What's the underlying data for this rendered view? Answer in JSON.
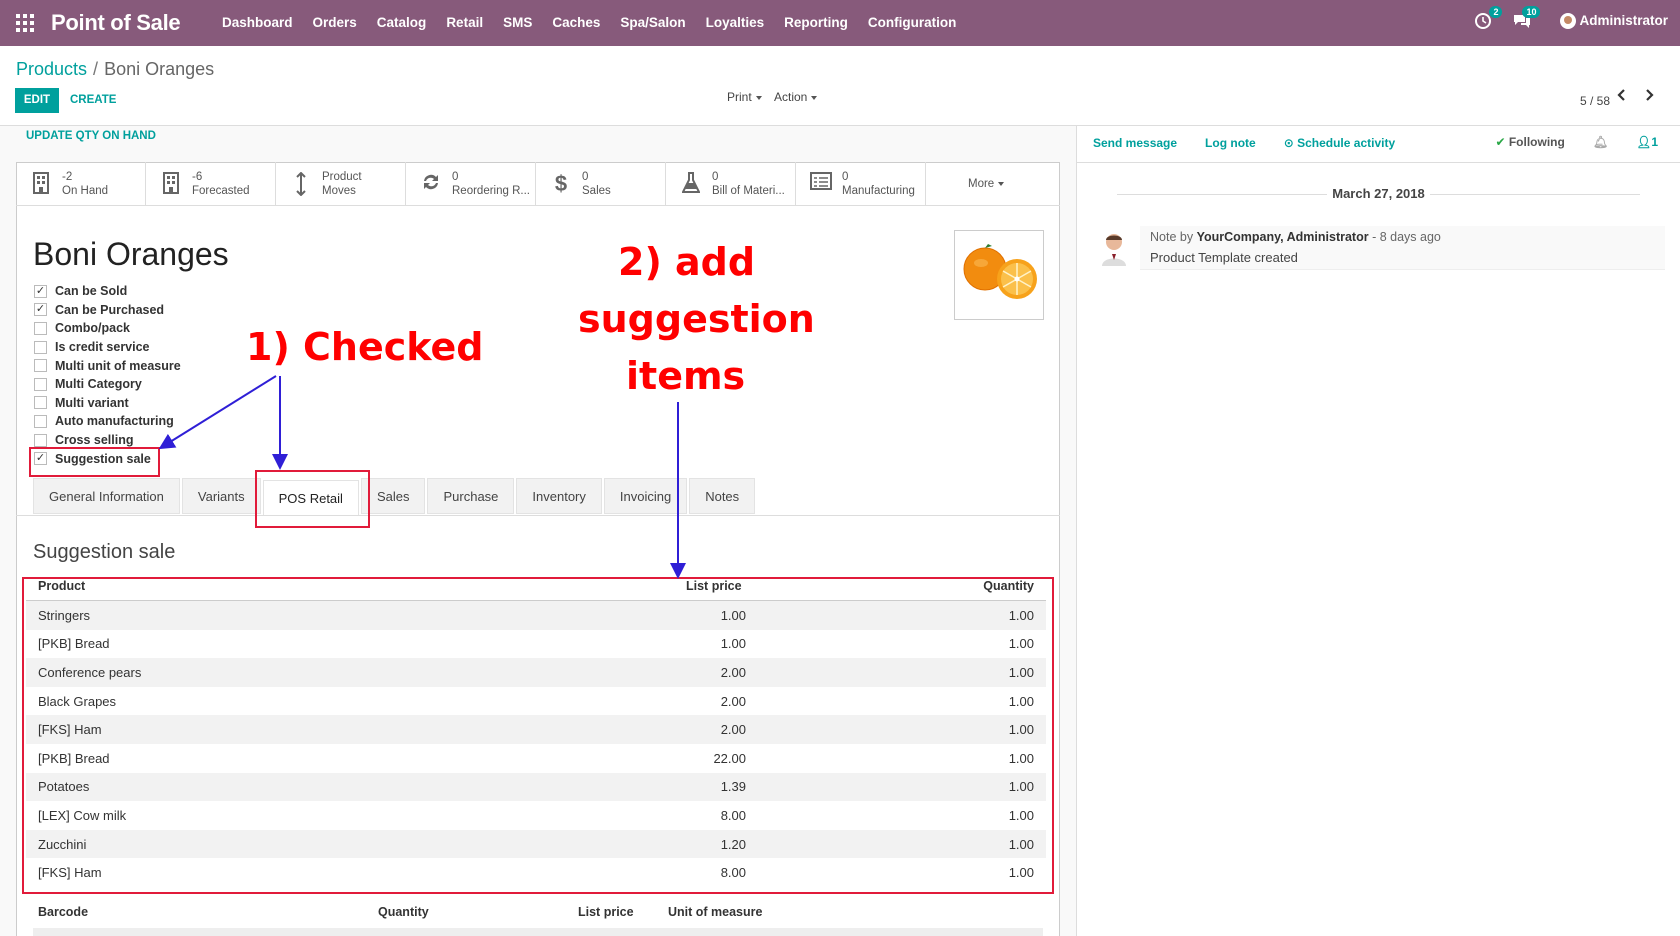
{
  "navbar": {
    "brand": "Point of Sale",
    "menu": [
      "Dashboard",
      "Orders",
      "Catalog",
      "Retail",
      "SMS",
      "Caches",
      "Spa/Salon",
      "Loyalties",
      "Reporting",
      "Configuration"
    ],
    "activity_count": "2",
    "message_count": "10",
    "user": "Administrator"
  },
  "breadcrumb": {
    "parent": "Products",
    "separator": "/",
    "current": "Boni Oranges"
  },
  "toolbar": {
    "edit": "EDIT",
    "create": "CREATE",
    "print": "Print",
    "action": "Action",
    "pager": "5 / 58"
  },
  "statusbar": {
    "update_qty": "UPDATE QTY ON HAND"
  },
  "smart_buttons": [
    {
      "value": "-2",
      "label": "On Hand",
      "icon": "building-icon"
    },
    {
      "value": "-6",
      "label": "Forecasted",
      "icon": "building-icon"
    },
    {
      "value": "Product",
      "label": "Moves",
      "icon": "arrows-v-icon"
    },
    {
      "value": "0",
      "label": "Reordering R...",
      "icon": "refresh-icon"
    },
    {
      "value": "0",
      "label": "Sales",
      "icon": "dollar-icon"
    },
    {
      "value": "0",
      "label": "Bill of Materi...",
      "icon": "flask-icon"
    },
    {
      "value": "0",
      "label": "Manufacturing",
      "icon": "list-alt-icon"
    }
  ],
  "more": "More",
  "product": {
    "name": "Boni Oranges",
    "flags": [
      {
        "label": "Can be Sold",
        "checked": true
      },
      {
        "label": "Can be Purchased",
        "checked": true
      },
      {
        "label": "Combo/pack",
        "checked": false
      },
      {
        "label": "Is credit service",
        "checked": false
      },
      {
        "label": "Multi unit of measure",
        "checked": false
      },
      {
        "label": "Multi Category",
        "checked": false
      },
      {
        "label": "Multi variant",
        "checked": false
      },
      {
        "label": "Auto manufacturing",
        "checked": false
      },
      {
        "label": "Cross selling",
        "checked": false
      },
      {
        "label": "Suggestion sale",
        "checked": true
      }
    ]
  },
  "tabs": [
    "General Information",
    "Variants",
    "POS Retail",
    "Sales",
    "Purchase",
    "Inventory",
    "Invoicing",
    "Notes"
  ],
  "active_tab": "POS Retail",
  "section_title": "Suggestion sale",
  "suggestion_table": {
    "headers": [
      "Product",
      "List price",
      "Quantity"
    ],
    "rows": [
      [
        "Stringers",
        "1.00",
        "1.00"
      ],
      [
        "[PKB] Bread",
        "1.00",
        "1.00"
      ],
      [
        "Conference pears",
        "2.00",
        "1.00"
      ],
      [
        "Black Grapes",
        "2.00",
        "1.00"
      ],
      [
        "[FKS] Ham",
        "2.00",
        "1.00"
      ],
      [
        "[PKB] Bread",
        "22.00",
        "1.00"
      ],
      [
        "Potatoes",
        "1.39",
        "1.00"
      ],
      [
        "[LEX] Cow milk",
        "8.00",
        "1.00"
      ],
      [
        "Zucchini",
        "1.20",
        "1.00"
      ],
      [
        "[FKS] Ham",
        "8.00",
        "1.00"
      ]
    ]
  },
  "barcode_table": {
    "headers": [
      "Barcode",
      "Quantity",
      "List price",
      "Unit of measure"
    ]
  },
  "chatter": {
    "send_message": "Send message",
    "log_note": "Log note",
    "schedule_activity": "Schedule activity",
    "following": "Following",
    "followers": "1",
    "date": "March 27, 2018",
    "message": {
      "prefix": "Note by",
      "author": "YourCompany, Administrator",
      "when": "- 8 days ago",
      "body": "Product Template created"
    }
  },
  "annotations": {
    "step1": "1) Checked",
    "step2_line1": "2) add",
    "step2_line2": "suggestion",
    "step2_line3": "items"
  },
  "colors": {
    "navbar": "#875a7b",
    "primary": "#00a09d",
    "annotation": "#ff0000",
    "arrow": "#2f1fd6"
  }
}
